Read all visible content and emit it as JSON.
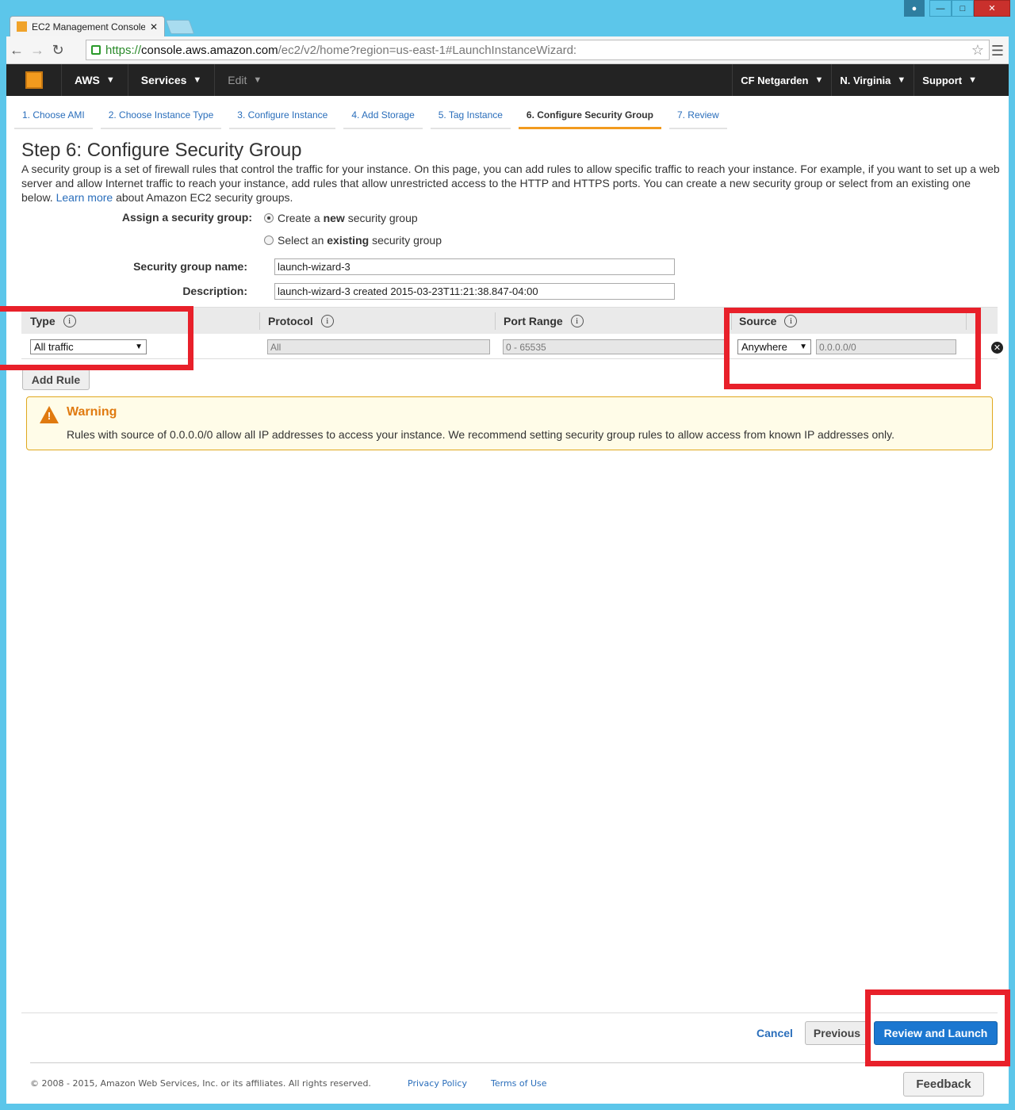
{
  "browser": {
    "tab_title": "EC2 Management Console",
    "url_https": "https://",
    "url_host": "console.aws.amazon.com",
    "url_rest": "/ec2/v2/home?region=us-east-1#LaunchInstanceWizard:"
  },
  "awsbar": {
    "aws": "AWS",
    "services": "Services",
    "edit": "Edit",
    "account": "CF Netgarden",
    "region": "N. Virginia",
    "support": "Support"
  },
  "steps": [
    "1. Choose AMI",
    "2. Choose Instance Type",
    "3. Configure Instance",
    "4. Add Storage",
    "5. Tag Instance",
    "6. Configure Security Group",
    "7. Review"
  ],
  "page": {
    "title": "Step 6: Configure Security Group",
    "intro_text": "A security group is a set of firewall rules that control the traffic for your instance. On this page, you can add rules to allow specific traffic to reach your instance. For example, if you want to set up a web server and allow Internet traffic to reach your instance, add rules that allow unrestricted access to the HTTP and HTTPS ports. You can create a new security group or select from an existing one below.",
    "learn_more": "Learn more",
    "intro_suffix": "about Amazon EC2 security groups."
  },
  "form": {
    "assign_label": "Assign a security group:",
    "option_new_prefix": "Create a",
    "option_new_bold": "new",
    "option_new_suffix": "security group",
    "option_existing_prefix": "Select an",
    "option_existing_bold": "existing",
    "option_existing_suffix": "security group",
    "name_label": "Security group name:",
    "name_value": "launch-wizard-3",
    "desc_label": "Description:",
    "desc_value": "launch-wizard-3 created 2015-03-23T11:21:38.847-04:00"
  },
  "rules": {
    "headers": {
      "type": "Type",
      "protocol": "Protocol",
      "port_range": "Port Range",
      "source": "Source"
    },
    "row": {
      "type": "All traffic",
      "protocol": "All",
      "port_range": "0 - 65535",
      "source_select": "Anywhere",
      "source_cidr": "0.0.0.0/0"
    },
    "add_rule": "Add Rule"
  },
  "warning": {
    "title": "Warning",
    "text": "Rules with source of 0.0.0.0/0 allow all IP addresses to access your instance. We recommend setting security group rules to allow access from known IP addresses only."
  },
  "actions": {
    "cancel": "Cancel",
    "previous": "Previous",
    "review_launch": "Review and Launch"
  },
  "footer": {
    "copyright": "© 2008 - 2015, Amazon Web Services, Inc. or its affiliates. All rights reserved.",
    "privacy": "Privacy Policy",
    "terms": "Terms of Use",
    "feedback": "Feedback"
  },
  "colors": {
    "accent_orange": "#f29a1e",
    "primary_blue": "#1b77d0",
    "annotation_red": "#e8202a"
  }
}
